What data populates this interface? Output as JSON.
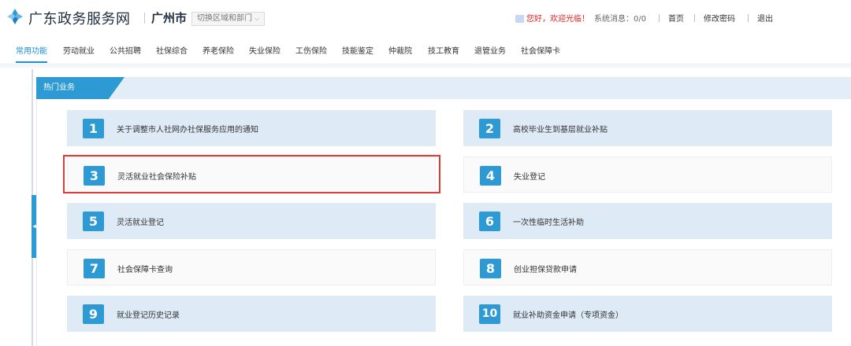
{
  "header": {
    "site_title": "广东政务服务网",
    "city": "广州市",
    "region_switch": "切换区域和部门",
    "welcome": "您好，欢迎光临！",
    "system_message": "系统消息：0/0",
    "links": [
      "首页",
      "修改密码",
      "退出"
    ]
  },
  "nav": {
    "items": [
      "常用功能",
      "劳动就业",
      "公共招聘",
      "社保综合",
      "养老保险",
      "失业保险",
      "工伤保险",
      "技能鉴定",
      "仲裁院",
      "技工教育",
      "退管业务",
      "社会保障卡"
    ],
    "active_index": 0
  },
  "section": {
    "title": "热门业务"
  },
  "services": [
    {
      "num": "1",
      "label": "关于调整市人社网办社保服务应用的通知"
    },
    {
      "num": "2",
      "label": "高校毕业生到基层就业补贴"
    },
    {
      "num": "3",
      "label": "灵活就业社会保险补贴"
    },
    {
      "num": "4",
      "label": "失业登记"
    },
    {
      "num": "5",
      "label": "灵活就业登记"
    },
    {
      "num": "6",
      "label": "一次性临时生活补助"
    },
    {
      "num": "7",
      "label": "社会保障卡查询"
    },
    {
      "num": "8",
      "label": "创业担保贷款申请"
    },
    {
      "num": "9",
      "label": "就业登记历史记录"
    },
    {
      "num": "10",
      "label": "就业补助资金申请（专项资金）"
    }
  ],
  "colors": {
    "accent": "#2e9ad4",
    "highlight_border": "#e53935",
    "welcome_text": "#e02020"
  },
  "icons": {
    "logo": "guangdong-logo-icon",
    "dropdown": "chevron-down-icon",
    "collapse": "chevron-left-icon"
  }
}
